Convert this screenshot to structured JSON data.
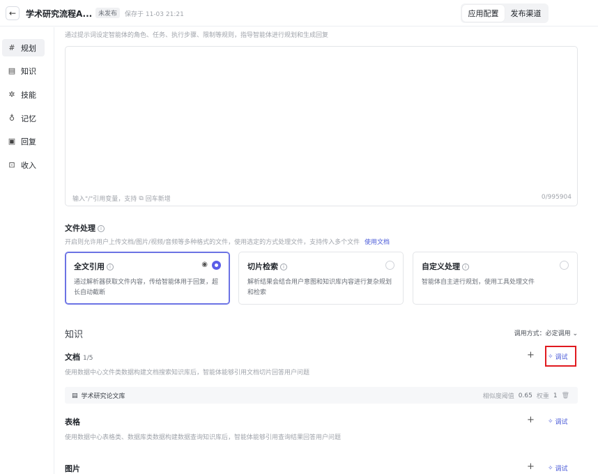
{
  "header": {
    "back_icon": "arrow-left-icon",
    "title": "学术研究流程A...",
    "status": "未发布",
    "save_time": "保存于 11-03 21:21",
    "tabs": [
      {
        "label": "应用配置",
        "active": true
      },
      {
        "label": "发布渠道",
        "active": false
      }
    ]
  },
  "sidebar": {
    "items": [
      {
        "label": "规划",
        "icon": "hash-icon",
        "active": true
      },
      {
        "label": "知识",
        "icon": "book-icon",
        "active": false
      },
      {
        "label": "技能",
        "icon": "sparkle-icon",
        "active": false
      },
      {
        "label": "记忆",
        "icon": "bulb-icon",
        "active": false
      },
      {
        "label": "回复",
        "icon": "reply-icon",
        "active": false
      },
      {
        "label": "收入",
        "icon": "bag-icon",
        "active": false
      }
    ]
  },
  "prompt": {
    "hint": "通过提示词设定智能体的角色、任务、执行步骤、限制等规则，指导智能体进行规划和生成回复",
    "placeholder_prefix": "输入\"/\"引用变量，支持",
    "placeholder_suffix": "回车新增",
    "counter": "0/995904"
  },
  "file_processing": {
    "title": "文件处理",
    "desc": "开启则允许用户上传文档/图片/视频/音频等多种格式的文件，使用选定的方式处理文件，支持传入多个文件",
    "doc_link": "使用文档",
    "options": [
      {
        "title": "全文引用",
        "desc": "通过解析器获取文件内容，传给智能体用于回复，超长自动截断",
        "selected": true
      },
      {
        "title": "切片检索",
        "desc": "解析结果会结合用户意图和知识库内容进行复杂规划和检索",
        "selected": false
      },
      {
        "title": "自定义处理",
        "desc": "智能体自主进行规划，使用工具处理文件",
        "selected": false
      }
    ]
  },
  "knowledge": {
    "heading": "知识",
    "call_mode": "调用方式：必定调用",
    "add_label": "+",
    "debug_label": "调试",
    "docs": {
      "title": "文档",
      "count": "1/5",
      "desc": "使用数据中心文件类数据构建文档搜索知识库后，智能体能够引用文档切片回答用户问题",
      "items": [
        {
          "name": "学术研究论文库",
          "threshold_label": "相似度阈值",
          "threshold": "0.65",
          "weight_label": "权重",
          "weight": "1"
        }
      ]
    },
    "tables": {
      "title": "表格",
      "desc": "使用数据中心表格类、数据库类数据构建数据查询知识库后，智能体能够引用查询结果回答用户问题"
    },
    "images": {
      "title": "图片"
    }
  },
  "colors": {
    "accent": "#5b5ee8",
    "link": "#4b5bd8",
    "highlight": "#e0191e"
  }
}
